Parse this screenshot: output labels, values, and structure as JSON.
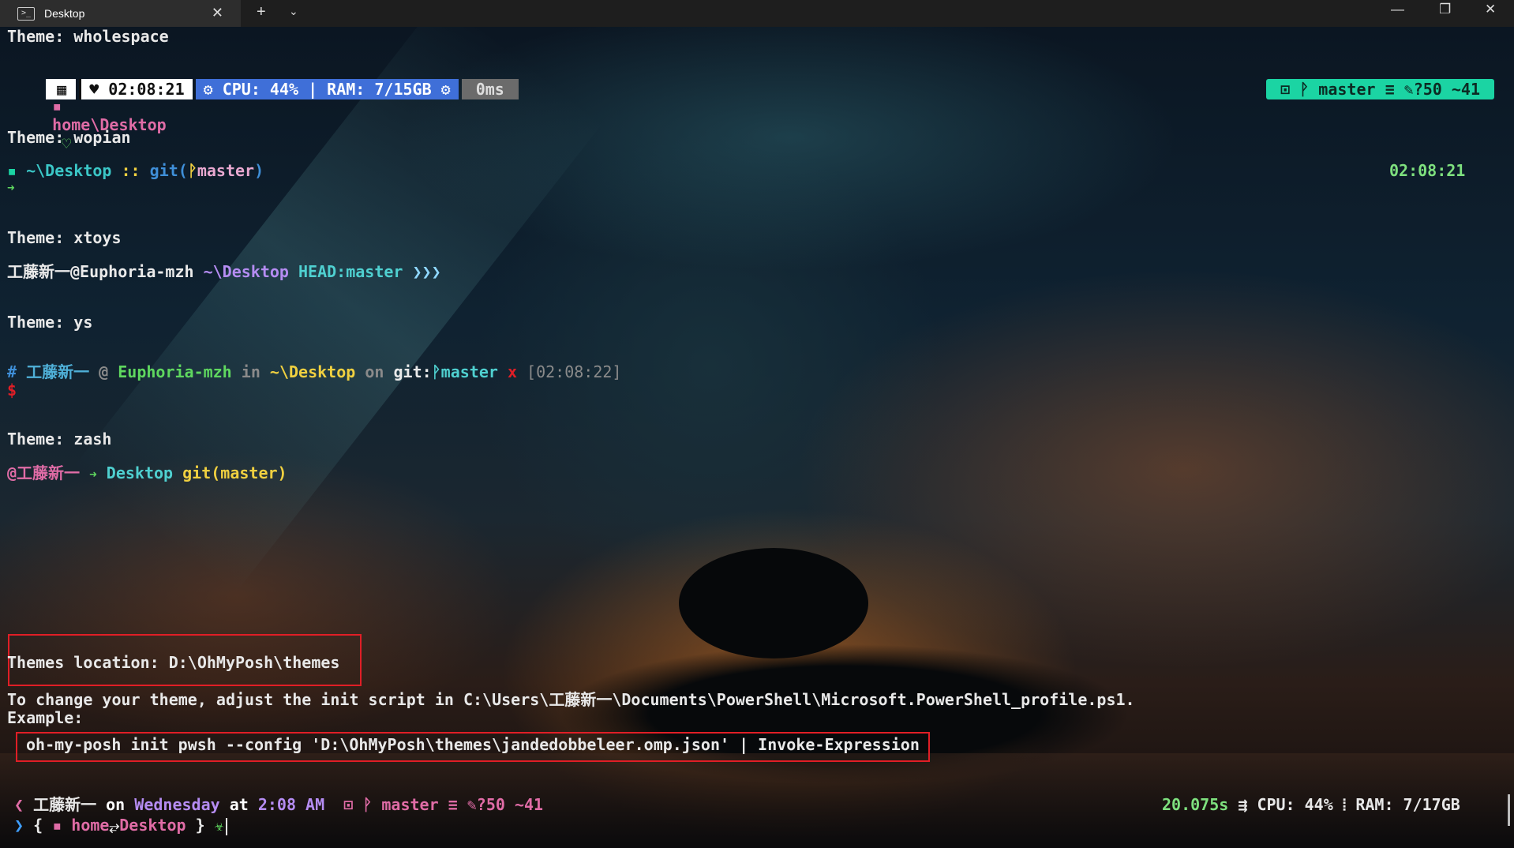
{
  "window": {
    "tab_title": "Desktop",
    "tab_icon": ">_",
    "close": "✕",
    "new_tab": "+",
    "dropdown": "⌄",
    "minimize": "—",
    "maximize": "❐",
    "close_window": "✕"
  },
  "colors": {
    "green": "#5fd75f",
    "teal": "#1bd4a3",
    "blue_bar": "#3f6fd8",
    "red": "#e01e26",
    "pink": "#e06ca6",
    "purple": "#b58cf2"
  },
  "wholespace": {
    "theme_label": "Theme: wholespace",
    "icon": "▦",
    "time": "♥ 02:08:21",
    "sys": "⚙ CPU: 44% | RAM: 7/15GB ⚙",
    "exec": "0ms",
    "git": "⊡ ᚹ master ≡ ✎?50 ~41",
    "path_icon": "▪",
    "path": "home\\Desktop",
    "heart": "♡"
  },
  "wopian": {
    "theme_label": "Theme: wopian",
    "icon": "▪",
    "path": "~\\Desktop",
    "sep": "::",
    "git_pre": "git(",
    "git_branch_icon": "ᚹ",
    "git_branch": "master",
    "git_post": ")",
    "time": "02:08:21",
    "arrow": "➜"
  },
  "xtoys": {
    "theme_label": "Theme: xtoys",
    "user": "工藤新一@Euphoria-mzh",
    "path": "~\\Desktop",
    "git": "HEAD:master",
    "chevrons": "❯❯❯"
  },
  "ys": {
    "theme_label": "Theme: ys",
    "hash": "#",
    "user": "工藤新一",
    "at": "@",
    "host": "Euphoria-mzh",
    "in": "in",
    "path": "~\\Desktop",
    "on": "on",
    "git": "git:",
    "branch_icon": "ᚹ",
    "branch": "master",
    "x": "x",
    "time": "[02:08:22]",
    "dollar": "$"
  },
  "zash": {
    "theme_label": "Theme: zash",
    "user": "@工藤新一",
    "arrow": "➜",
    "path": "Desktop",
    "git_pre": "git(",
    "git_branch": "master",
    "git_post": ")"
  },
  "info": {
    "themes_location": "Themes location: D:\\OhMyPosh\\themes",
    "change_text": "To change your theme, adjust the init script in C:\\Users\\工藤新一\\Documents\\PowerShell\\Microsoft.PowerShell_profile.ps1.",
    "example_label": "Example:",
    "example_cmd": "oh-my-posh init pwsh --config 'D:\\OhMyPosh\\themes\\jandedobbeleer.omp.json' | Invoke-Expression"
  },
  "prompt": {
    "left_chevron": "❮",
    "user": "工藤新一",
    "on": "on",
    "day": "Wednesday",
    "at": "at",
    "time": "2:08 AM",
    "git_icon": "⊡",
    "branch_icon": "ᚹ",
    "branch": "master",
    "status": "≡",
    "changes": "✎?50 ~41",
    "exec_time": "20.075s",
    "cpu_icon": "⇶",
    "cpu": "CPU: 44%",
    "ram_sep": "⦙",
    "ram": "RAM: 7/17GB",
    "right_chevron": "❯",
    "brace_open": "{",
    "folder_icon": "▪",
    "home": "home",
    "path_sep": "⥂",
    "desktop": "Desktop",
    "brace_close": "}",
    "symbol": "☣"
  }
}
